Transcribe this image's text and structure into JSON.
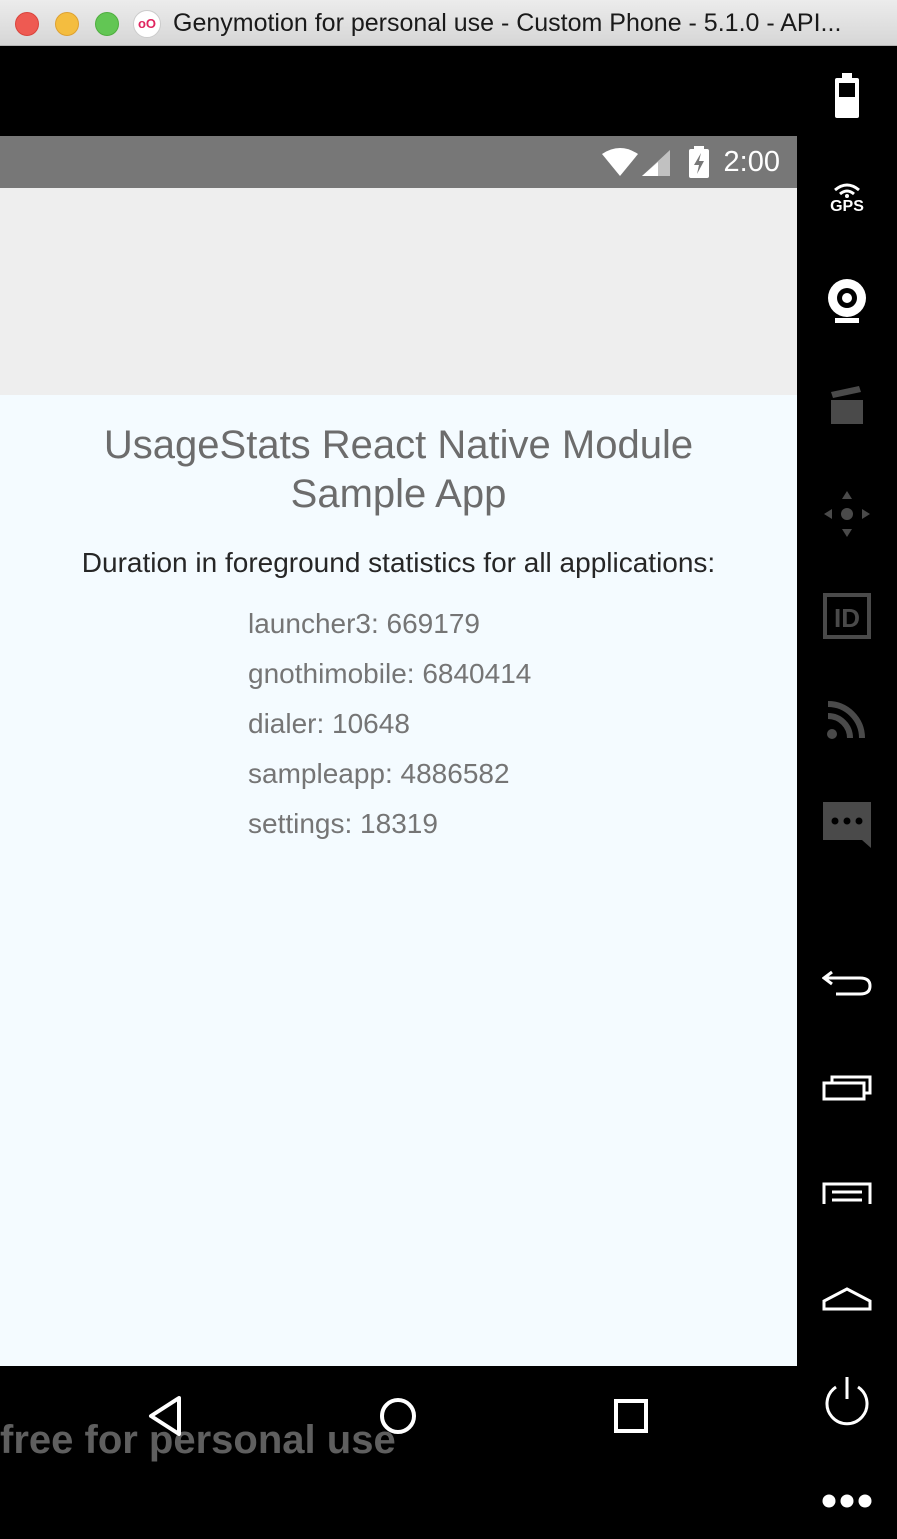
{
  "window": {
    "title": "Genymotion for personal use - Custom Phone - 5.1.0 - API...",
    "logo_text": "oO"
  },
  "status_bar": {
    "time": "2:00",
    "icons": [
      "wifi-icon",
      "cell-signal-icon",
      "battery-charging-icon"
    ]
  },
  "app": {
    "title": "UsageStats React Native Module\nSample App",
    "subtitle": "Duration in foreground statistics for all applications:",
    "stats": [
      "launcher3: 669179",
      "gnothimobile: 6840414",
      "dialer: 10648",
      "sampleapp: 4886582",
      "settings: 18319"
    ]
  },
  "navigation": {
    "watermark": "free for personal use",
    "buttons": [
      "back-icon",
      "home-icon",
      "recents-icon"
    ]
  },
  "sidebar": {
    "gps_label": "GPS",
    "tools": [
      "battery-icon",
      "gps-icon",
      "camera-icon",
      "capture-icon",
      "dpad-icon",
      "device-id-icon",
      "network-icon",
      "sms-icon",
      "back-icon",
      "recent-apps-icon",
      "menu-icon",
      "home-icon",
      "power-icon",
      "more-icon"
    ]
  },
  "colors": {
    "status_bar": "#777777",
    "action_bar": "#eeeeee",
    "content_bg": "#f4fbff"
  }
}
